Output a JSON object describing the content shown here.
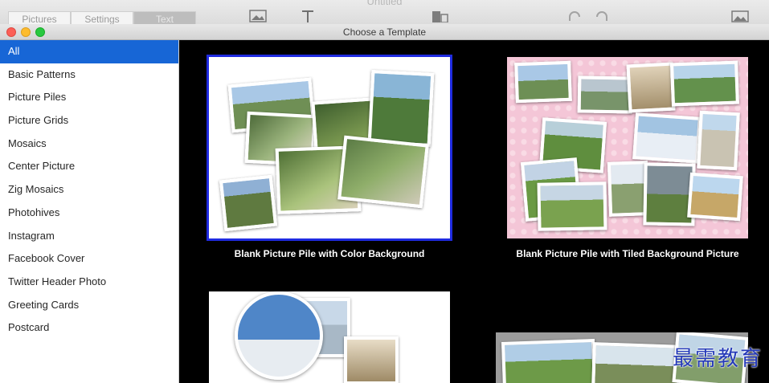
{
  "app": {
    "title": "Untitled",
    "tabs": [
      {
        "label": "Pictures"
      },
      {
        "label": "Settings"
      },
      {
        "label": "Text"
      }
    ]
  },
  "sheet": {
    "title": "Choose a Template",
    "categories": [
      {
        "label": "All",
        "selected": true
      },
      {
        "label": "Basic Patterns"
      },
      {
        "label": "Picture Piles"
      },
      {
        "label": "Picture Grids"
      },
      {
        "label": "Mosaics"
      },
      {
        "label": "Center Picture"
      },
      {
        "label": "Zig Mosaics"
      },
      {
        "label": "Photohives"
      },
      {
        "label": "Instagram"
      },
      {
        "label": "Facebook Cover"
      },
      {
        "label": "Twitter Header Photo"
      },
      {
        "label": "Greeting Cards"
      },
      {
        "label": "Postcard"
      }
    ],
    "templates": [
      {
        "caption": "Blank Picture Pile with Color Background",
        "selected": true
      },
      {
        "caption": "Blank Picture Pile with Tiled Background Picture"
      }
    ]
  },
  "colors": {
    "selection_blue": "#1766d6",
    "thumb_border": "#1f2be0",
    "tiled_background_pink": "#f4c6d7"
  },
  "watermark": "最需教育"
}
